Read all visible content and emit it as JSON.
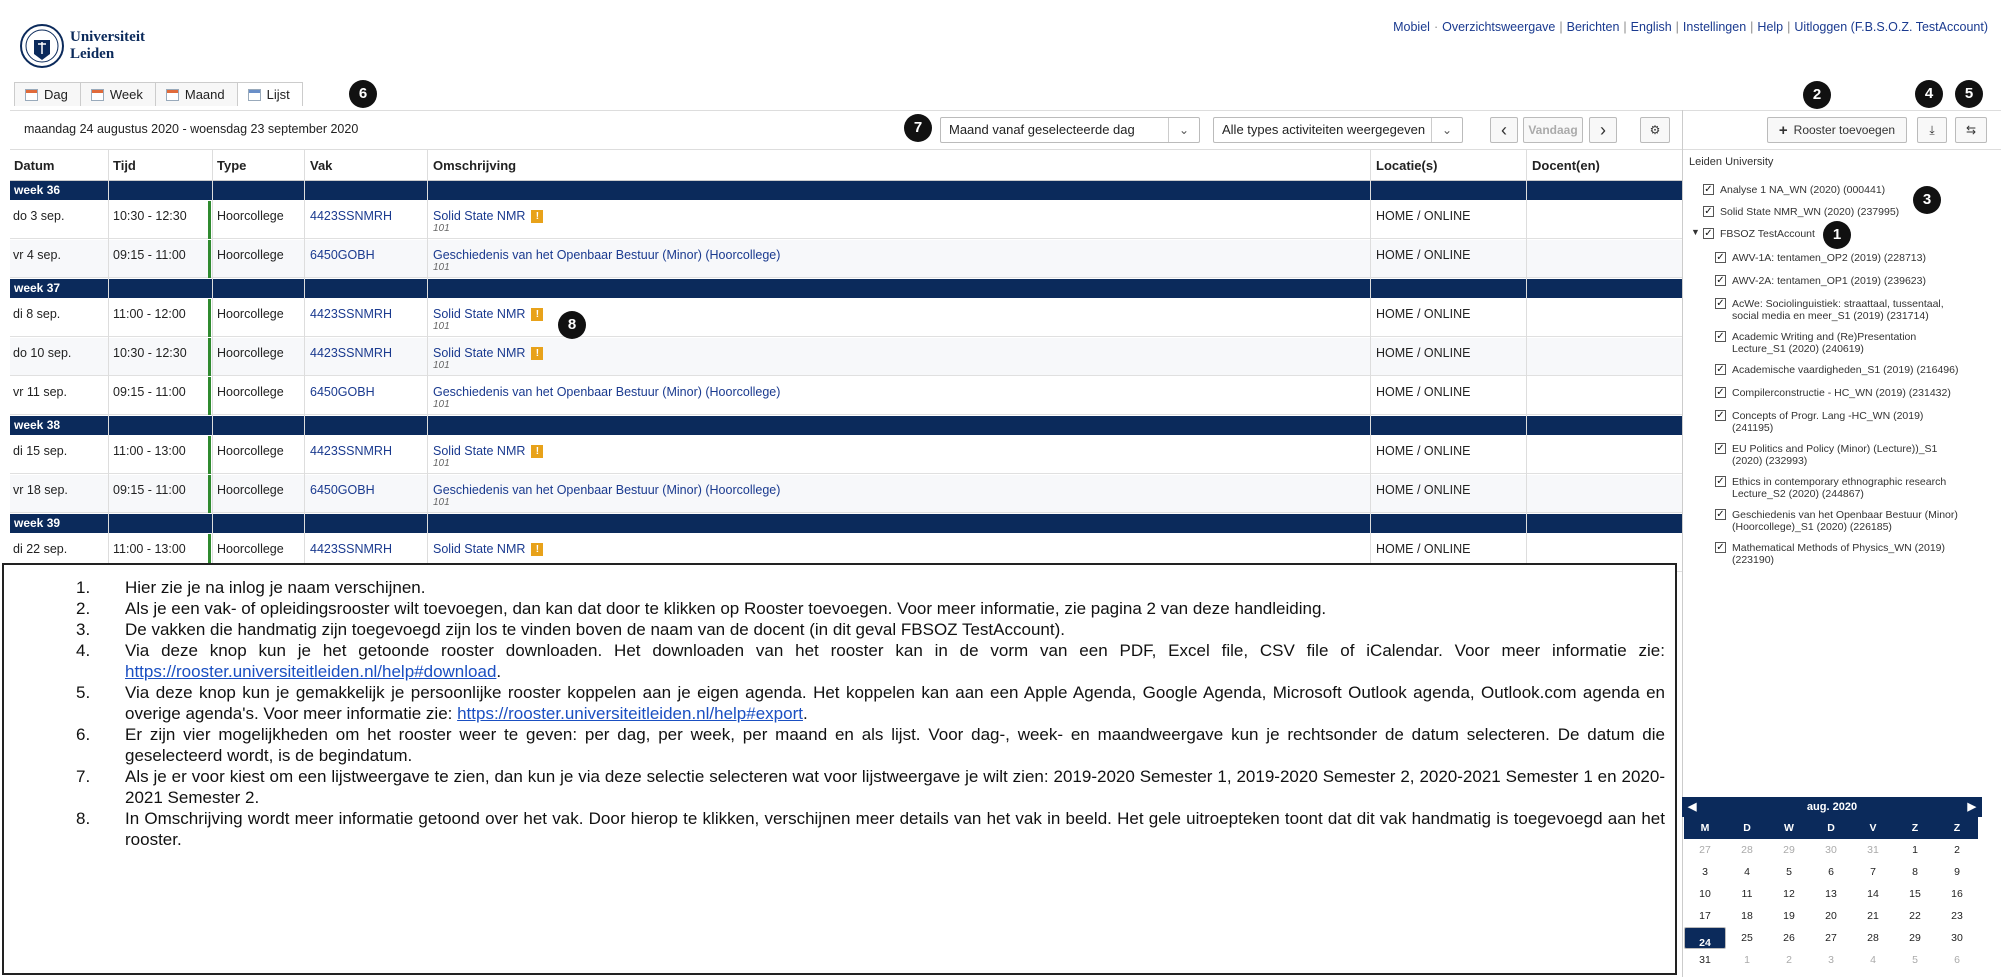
{
  "header": {
    "logo_text_1": "Universiteit",
    "logo_text_2": "Leiden",
    "links": [
      "Mobiel",
      "Overzichtsweergave",
      "Berichten",
      "English",
      "Instellingen",
      "Help",
      "Uitloggen (F.B.S.O.Z. TestAccount)"
    ]
  },
  "tabs": [
    "Dag",
    "Week",
    "Maand",
    "Lijst"
  ],
  "toolbar": {
    "range": "maandag 24 augustus 2020 - woensdag 23 september 2020",
    "view_select": "Maand vanaf geselecteerde dag",
    "type_select": "Alle types activiteiten weergegeven",
    "prev": "‹",
    "today": "Vandaag",
    "next": "›",
    "add_schedule": "Rooster toevoegen"
  },
  "table": {
    "columns": [
      "Datum",
      "Tijd",
      "Type",
      "Vak",
      "Omschrijving",
      "Locatie(s)",
      "Docent(en)"
    ],
    "weeks": [
      {
        "label": "week 36",
        "rows": [
          {
            "date": "do 3 sep.",
            "time": "10:30 - 12:30",
            "type": "Hoorcollege",
            "course": "4423SSNMRH",
            "desc": "Solid State NMR",
            "excl": true,
            "sub": "101",
            "loc": "HOME / ONLINE"
          },
          {
            "date": "vr 4 sep.",
            "time": "09:15 - 11:00",
            "type": "Hoorcollege",
            "course": "6450GOBH",
            "desc": "Geschiedenis van het Openbaar Bestuur (Minor) (Hoorcollege)",
            "excl": false,
            "sub": "101",
            "loc": "HOME / ONLINE"
          }
        ]
      },
      {
        "label": "week 37",
        "rows": [
          {
            "date": "di 8 sep.",
            "time": "11:00 - 12:00",
            "type": "Hoorcollege",
            "course": "4423SSNMRH",
            "desc": "Solid State NMR",
            "excl": true,
            "sub": "101",
            "loc": "HOME / ONLINE"
          },
          {
            "date": "do 10 sep.",
            "time": "10:30 - 12:30",
            "type": "Hoorcollege",
            "course": "4423SSNMRH",
            "desc": "Solid State NMR",
            "excl": true,
            "sub": "101",
            "loc": "HOME / ONLINE"
          },
          {
            "date": "vr 11 sep.",
            "time": "09:15 - 11:00",
            "type": "Hoorcollege",
            "course": "6450GOBH",
            "desc": "Geschiedenis van het Openbaar Bestuur (Minor) (Hoorcollege)",
            "excl": false,
            "sub": "101",
            "loc": "HOME / ONLINE"
          }
        ]
      },
      {
        "label": "week 38",
        "rows": [
          {
            "date": "di 15 sep.",
            "time": "11:00 - 13:00",
            "type": "Hoorcollege",
            "course": "4423SSNMRH",
            "desc": "Solid State NMR",
            "excl": true,
            "sub": "101",
            "loc": "HOME / ONLINE"
          },
          {
            "date": "vr 18 sep.",
            "time": "09:15 - 11:00",
            "type": "Hoorcollege",
            "course": "6450GOBH",
            "desc": "Geschiedenis van het Openbaar Bestuur (Minor) (Hoorcollege)",
            "excl": false,
            "sub": "101",
            "loc": "HOME / ONLINE"
          }
        ]
      },
      {
        "label": "week 39",
        "rows": [
          {
            "date": "di 22 sep.",
            "time": "11:00 - 13:00",
            "type": "Hoorcollege",
            "course": "4423SSNMRH",
            "desc": "Solid State NMR",
            "excl": true,
            "sub": "",
            "loc": "HOME / ONLINE"
          }
        ]
      }
    ]
  },
  "panel": {
    "heading": "Leiden University",
    "items": [
      {
        "text": "Analyse 1 NA_WN (2020) (000441)"
      },
      {
        "text": "Solid State NMR_WN (2020) (237995)"
      },
      {
        "text": "FBSOZ TestAccount"
      },
      {
        "text": "AWV-1A: tentamen_OP2 (2019) (228713)"
      },
      {
        "text": "AWV-2A: tentamen_OP1 (2019) (239623)"
      },
      {
        "text": "AcWe: Sociolinguistiek: straattaal, tussentaal,",
        "text2": "social media en meer_S1 (2019) (231714)"
      },
      {
        "text": "Academic Writing and (Re)Presentation",
        "text2": "Lecture_S1 (2020) (240619)"
      },
      {
        "text": "Academische vaardigheden_S1 (2019) (216496)"
      },
      {
        "text": "Compilerconstructie - HC_WN (2019) (231432)"
      },
      {
        "text": "Concepts of Progr. Lang -HC_WN (2019)",
        "text2": "(241195)"
      },
      {
        "text": "EU Politics and Policy (Minor) (Lecture))_S1",
        "text2": "(2020) (232993)"
      },
      {
        "text": "Ethics in contemporary ethnographic research",
        "text2": "Lecture_S2 (2020) (244867)"
      },
      {
        "text": "Geschiedenis van het Openbaar Bestuur (Minor)",
        "text2": "(Hoorcollege)_S1 (2020) (226185)"
      },
      {
        "text": "Mathematical Methods of Physics_WN (2019)",
        "text2": "(223190)"
      }
    ]
  },
  "calendar": {
    "month": "aug. 2020",
    "weekdays": [
      "M",
      "D",
      "W",
      "D",
      "V",
      "Z",
      "Z"
    ],
    "weeks": [
      [
        "27",
        "28",
        "29",
        "30",
        "31",
        "1",
        "2"
      ],
      [
        "3",
        "4",
        "5",
        "6",
        "7",
        "8",
        "9"
      ],
      [
        "10",
        "11",
        "12",
        "13",
        "14",
        "15",
        "16"
      ],
      [
        "17",
        "18",
        "19",
        "20",
        "21",
        "22",
        "23"
      ],
      [
        "24",
        "25",
        "26",
        "27",
        "28",
        "29",
        "30"
      ],
      [
        "31",
        "1",
        "2",
        "3",
        "4",
        "5",
        "6"
      ]
    ],
    "selected": "24"
  },
  "callouts": [
    "1",
    "2",
    "3",
    "4",
    "5",
    "6",
    "7",
    "8"
  ],
  "instructions": [
    {
      "n": "1.",
      "text": "Hier zie je na inlog je naam verschijnen."
    },
    {
      "n": "2.",
      "text": "Als je een vak- of opleidingsrooster wilt toevoegen, dan kan dat door te klikken op Rooster toevoegen. Voor meer informatie, zie pagina 2 van deze handleiding."
    },
    {
      "n": "3.",
      "text": "De vakken die handmatig zijn toegevoegd zijn los te vinden boven de naam van de docent (in dit geval FBSOZ TestAccount)."
    },
    {
      "n": "4.",
      "text": "Via deze knop kun je het getoonde rooster downloaden. Het downloaden van het rooster kan in de vorm van een PDF, Excel file, CSV file of iCalendar. Voor meer informatie zie: ",
      "link": "https://rooster.universiteitleiden.nl/help#download",
      "after": "."
    },
    {
      "n": "5.",
      "text": "Via deze knop kun je gemakkelijk je persoonlijke rooster koppelen aan je eigen agenda. Het koppelen kan aan een Apple Agenda, Google Agenda, Microsoft Outlook agenda, Outlook.com agenda en overige agenda's. Voor meer informatie zie: ",
      "link": "https://rooster.universiteitleiden.nl/help#export",
      "after": "."
    },
    {
      "n": "6.",
      "text": "Er zijn vier mogelijkheden om het rooster weer te geven: per dag, per week, per maand en als lijst. Voor dag-, week- en maandweergave kun je rechtsonder de datum selecteren. De datum die geselecteerd wordt, is de begindatum."
    },
    {
      "n": "7.",
      "text": "Als je er voor kiest om een lijstweergave te zien, dan kun je via deze selectie selecteren wat voor lijstweergave je wilt zien: 2019-2020 Semester 1, 2019-2020 Semester 2, 2020-2021 Semester 1 en 2020-2021 Semester 2."
    },
    {
      "n": "8.",
      "text": "In Omschrijving wordt meer informatie getoond over het vak. Door hierop te klikken, verschijnen meer details van het vak in beeld. Het gele uitroepteken toont dat dit vak handmatig is toegevoegd aan het rooster."
    }
  ]
}
